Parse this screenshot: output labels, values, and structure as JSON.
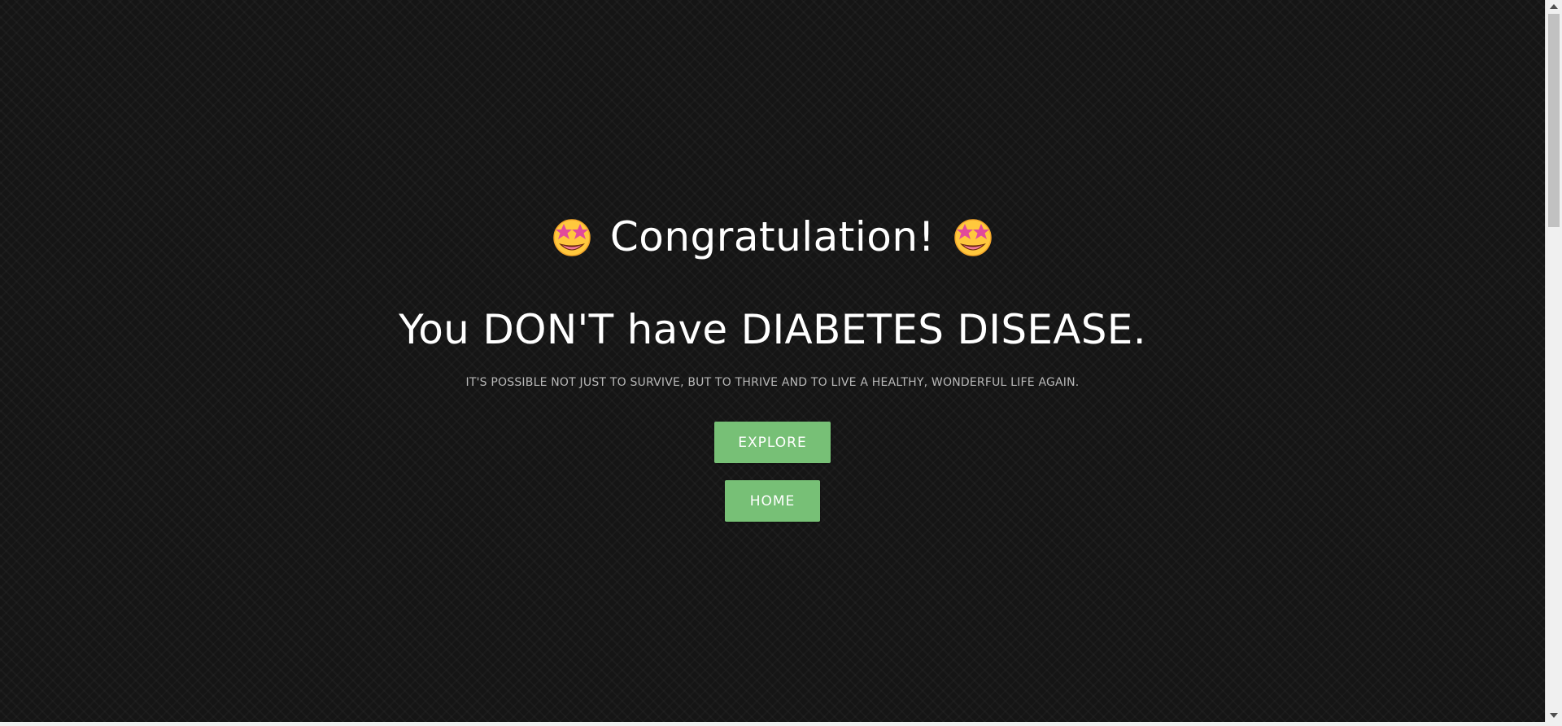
{
  "hero": {
    "greeting": "Congratulation!",
    "greeting_icon": "star-struck-emoji",
    "headline": "You DON'T have DIABETES DISEASE.",
    "tagline": "IT'S POSSIBLE NOT JUST TO SURVIVE, BUT TO THRIVE AND TO LIVE A HEALTHY, WONDERFUL LIFE AGAIN."
  },
  "buttons": {
    "explore_label": "EXPLORE",
    "home_label": "HOME"
  },
  "colors": {
    "background": "#151515",
    "button": "#77c076",
    "text": "#ffffff",
    "tagline": "#b9b9b9"
  }
}
